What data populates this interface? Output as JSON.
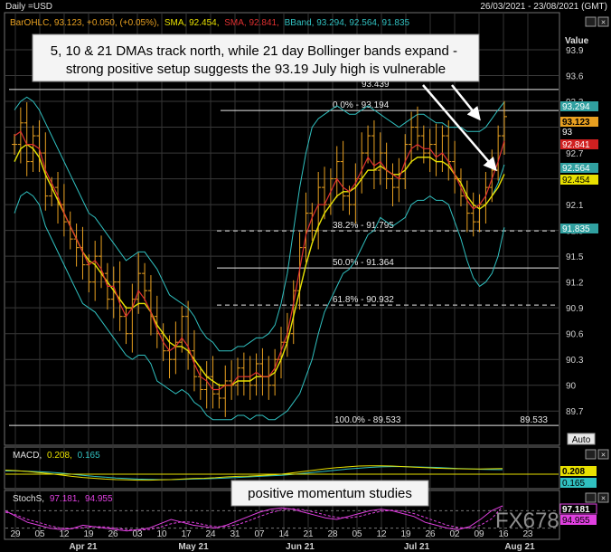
{
  "header": {
    "title": "Daily =USD",
    "date_range": "26/03/2021 - 23/08/2021 (GMT)",
    "value_label": "Value",
    "auto_label": "Auto",
    "watermark": "FX678"
  },
  "legend_main": [
    {
      "text": "BarOHLC, 93.123, +0.050, (+0.05%),",
      "color": "#e8a020"
    },
    {
      "text": "SMA, 92.454,",
      "color": "#e8e000"
    },
    {
      "text": "SMA, 92.841,",
      "color": "#e03030"
    },
    {
      "text": "BBand, 93.294, 92.564, 91.835",
      "color": "#30c0c0"
    }
  ],
  "annotation_main": "5, 10 & 21 DMAs track north, while 21 day Bollinger bands expand - strong positive setup suggests the 93.19 July high is vulnerable",
  "annotation_momentum": "positive momentum studies",
  "macd_legend": {
    "name": "MACD,",
    "v1": "0.208,",
    "v2": "0.165"
  },
  "stoch_legend": {
    "name": "StochS,",
    "v1": "97.181,",
    "v2": "94.955"
  },
  "colors": {
    "bar": "#e8a020",
    "sma_fast": "#e03030",
    "sma_slow": "#e8e000",
    "bband": "#30c0c0",
    "macd_line": "#e8e000",
    "macd_signal": "#30c0c0",
    "stoch_k": "#e040e0",
    "stoch_d": "#e040e0"
  },
  "chart_data": {
    "type": "line",
    "y_range": [
      89.45,
      94.1
    ],
    "y_ticks": [
      "93.9",
      "93.6",
      "93.3",
      "93",
      "92.7",
      "92.4",
      "92.1",
      "91.8",
      "91.5",
      "91.2",
      "90.9",
      "90.6",
      "90.3",
      "90",
      "89.7"
    ],
    "y_tick_values": [
      93.9,
      93.6,
      93.3,
      93.0,
      92.7,
      92.4,
      92.1,
      91.8,
      91.5,
      91.2,
      90.9,
      90.6,
      90.3,
      90.0,
      89.7
    ],
    "x_ticks": [
      "29",
      "05",
      "12",
      "19",
      "26",
      "03",
      "10",
      "17",
      "24",
      "31",
      "07",
      "14",
      "21",
      "28",
      "05",
      "12",
      "19",
      "26",
      "02",
      "09",
      "16",
      "23"
    ],
    "month_labels": [
      "Apr 21",
      "May 21",
      "Jun 21",
      "Jul 21",
      "Aug 21"
    ],
    "levels": [
      {
        "label": "93.439",
        "value": 93.439
      },
      {
        "label": "0.0% - 93.194",
        "value": 93.194
      },
      {
        "label": "38.2% - 91.795",
        "value": 91.795
      },
      {
        "label": "50.0% - 91.364",
        "value": 91.364
      },
      {
        "label": "61.8% - 90.932",
        "value": 90.932
      },
      {
        "label": "100.0% - 89.533",
        "value": 89.533
      }
    ],
    "level_right_label": "89.533",
    "price_tags": [
      {
        "text": "93.294",
        "value": 93.294,
        "bg": "#30a0a0",
        "fg": "#ffffff"
      },
      {
        "text": "93.123",
        "value": 93.123,
        "bg": "#e8a020",
        "fg": "#000000"
      },
      {
        "text": "93",
        "value": 93.0,
        "bg": "#000000",
        "fg": "#ffffff"
      },
      {
        "text": "92.841",
        "value": 92.841,
        "bg": "#d02020",
        "fg": "#ffffff"
      },
      {
        "text": "92.564",
        "value": 92.564,
        "bg": "#30a0a0",
        "fg": "#ffffff"
      },
      {
        "text": "92.454",
        "value": 92.454,
        "bg": "#e8e000",
        "fg": "#000000"
      },
      {
        "text": "91.835",
        "value": 91.835,
        "bg": "#30a0a0",
        "fg": "#ffffff"
      }
    ],
    "close": [
      92.8,
      93.05,
      92.6,
      92.9,
      92.7,
      92.2,
      92.3,
      92.1,
      91.9,
      91.7,
      91.6,
      91.4,
      91.2,
      91.5,
      91.3,
      91.0,
      91.2,
      90.8,
      90.6,
      91.0,
      91.3,
      91.1,
      90.8,
      90.6,
      90.4,
      90.3,
      90.5,
      90.8,
      90.4,
      90.1,
      89.95,
      90.1,
      89.9,
      89.85,
      90.05,
      90.0,
      90.2,
      90.1,
      90.0,
      90.25,
      90.1,
      90.0,
      90.3,
      90.5,
      90.6,
      91.1,
      91.6,
      92.0,
      91.8,
      92.3,
      92.1,
      92.4,
      92.6,
      92.2,
      92.1,
      92.4,
      92.7,
      92.9,
      92.5,
      92.7,
      92.4,
      92.3,
      92.4,
      92.8,
      93.0,
      92.9,
      92.7,
      92.8,
      92.6,
      92.9,
      92.6,
      92.4,
      92.2,
      92.0,
      91.9,
      92.1,
      92.3,
      92.5,
      92.9,
      93.123
    ],
    "sma_fast": [
      92.9,
      92.95,
      92.8,
      92.8,
      92.75,
      92.5,
      92.35,
      92.2,
      92.0,
      91.85,
      91.7,
      91.55,
      91.4,
      91.45,
      91.35,
      91.15,
      91.15,
      90.95,
      90.8,
      90.9,
      91.1,
      91.0,
      90.85,
      90.65,
      90.5,
      90.4,
      90.45,
      90.55,
      90.45,
      90.25,
      90.1,
      90.05,
      89.95,
      89.95,
      90.0,
      90.0,
      90.1,
      90.1,
      90.1,
      90.15,
      90.1,
      90.1,
      90.2,
      90.4,
      90.6,
      90.95,
      91.35,
      91.75,
      91.95,
      92.1,
      92.1,
      92.25,
      92.4,
      92.3,
      92.25,
      92.35,
      92.5,
      92.65,
      92.55,
      92.6,
      92.5,
      92.45,
      92.4,
      92.6,
      92.75,
      92.8,
      92.75,
      92.75,
      92.65,
      92.7,
      92.6,
      92.45,
      92.3,
      92.15,
      92.05,
      92.1,
      92.2,
      92.4,
      92.6,
      92.841
    ],
    "sma_slow": [
      92.6,
      92.75,
      92.8,
      92.75,
      92.65,
      92.45,
      92.3,
      92.15,
      92.0,
      91.85,
      91.7,
      91.55,
      91.45,
      91.4,
      91.3,
      91.2,
      91.1,
      91.0,
      90.9,
      90.9,
      90.95,
      90.95,
      90.85,
      90.7,
      90.6,
      90.5,
      90.45,
      90.45,
      90.4,
      90.3,
      90.2,
      90.1,
      90.05,
      90.0,
      90.0,
      90.0,
      90.05,
      90.05,
      90.05,
      90.1,
      90.1,
      90.1,
      90.15,
      90.3,
      90.5,
      90.8,
      91.1,
      91.4,
      91.65,
      91.85,
      92.0,
      92.1,
      92.2,
      92.25,
      92.25,
      92.3,
      92.4,
      92.5,
      92.5,
      92.55,
      92.5,
      92.45,
      92.45,
      92.5,
      92.6,
      92.65,
      92.65,
      92.65,
      92.6,
      92.6,
      92.55,
      92.45,
      92.35,
      92.2,
      92.1,
      92.05,
      92.1,
      92.2,
      92.3,
      92.454
    ],
    "bb_upper": [
      93.2,
      93.3,
      93.35,
      93.3,
      93.2,
      93.05,
      92.9,
      92.75,
      92.6,
      92.45,
      92.3,
      92.15,
      92.0,
      91.95,
      91.85,
      91.75,
      91.65,
      91.55,
      91.45,
      91.5,
      91.55,
      91.55,
      91.45,
      91.35,
      91.2,
      91.05,
      91.0,
      90.95,
      90.9,
      90.8,
      90.65,
      90.55,
      90.5,
      90.4,
      90.4,
      90.4,
      90.45,
      90.45,
      90.5,
      90.55,
      90.55,
      90.6,
      90.7,
      90.95,
      91.3,
      91.8,
      92.3,
      92.7,
      93.0,
      93.1,
      93.15,
      93.2,
      93.25,
      93.2,
      93.15,
      93.15,
      93.2,
      93.25,
      93.2,
      93.15,
      93.1,
      93.05,
      93.0,
      93.05,
      93.1,
      93.15,
      93.15,
      93.1,
      93.05,
      93.05,
      93.0,
      93.0,
      93.0,
      92.95,
      92.95,
      92.95,
      93.0,
      93.1,
      93.2,
      93.294
    ],
    "bb_mid": [
      92.6,
      92.75,
      92.8,
      92.75,
      92.65,
      92.45,
      92.3,
      92.15,
      92.0,
      91.85,
      91.7,
      91.55,
      91.45,
      91.4,
      91.3,
      91.2,
      91.1,
      91.0,
      90.9,
      90.9,
      90.95,
      90.95,
      90.85,
      90.7,
      90.6,
      90.5,
      90.45,
      90.45,
      90.4,
      90.3,
      90.2,
      90.1,
      90.05,
      90.0,
      90.0,
      90.0,
      90.05,
      90.05,
      90.05,
      90.1,
      90.1,
      90.1,
      90.15,
      90.3,
      90.5,
      90.8,
      91.1,
      91.4,
      91.65,
      91.85,
      92.0,
      92.1,
      92.2,
      92.25,
      92.25,
      92.3,
      92.4,
      92.5,
      92.5,
      92.55,
      92.5,
      92.45,
      92.45,
      92.5,
      92.6,
      92.65,
      92.65,
      92.65,
      92.6,
      92.6,
      92.55,
      92.45,
      92.35,
      92.2,
      92.1,
      92.05,
      92.1,
      92.2,
      92.35,
      92.564
    ],
    "bb_lower": [
      92.0,
      92.2,
      92.25,
      92.2,
      92.1,
      91.85,
      91.7,
      91.55,
      91.4,
      91.25,
      91.1,
      90.95,
      90.9,
      90.85,
      90.75,
      90.65,
      90.55,
      90.45,
      90.35,
      90.3,
      90.35,
      90.35,
      90.25,
      90.05,
      90.0,
      89.95,
      89.9,
      89.95,
      89.9,
      89.8,
      89.75,
      89.65,
      89.6,
      89.6,
      89.6,
      89.6,
      89.65,
      89.65,
      89.6,
      89.65,
      89.65,
      89.6,
      89.6,
      89.65,
      89.7,
      89.8,
      89.9,
      90.1,
      90.3,
      90.6,
      90.85,
      91.0,
      91.15,
      91.3,
      91.35,
      91.45,
      91.6,
      91.75,
      91.8,
      91.95,
      91.9,
      91.85,
      91.9,
      91.95,
      92.1,
      92.15,
      92.15,
      92.2,
      92.15,
      92.15,
      92.1,
      91.9,
      91.7,
      91.45,
      91.25,
      91.15,
      91.2,
      91.3,
      91.5,
      91.835
    ],
    "macd": [
      0.15,
      0.13,
      0.1,
      0.06,
      0.02,
      -0.03,
      -0.08,
      -0.12,
      -0.15,
      -0.18,
      -0.2,
      -0.21,
      -0.22,
      -0.22,
      -0.21,
      -0.2,
      -0.18,
      -0.16,
      -0.15,
      -0.13,
      -0.1,
      -0.08,
      -0.07,
      -0.05,
      -0.03,
      0.0,
      0.05,
      0.1,
      0.15,
      0.2,
      0.24,
      0.27,
      0.3,
      0.31,
      0.31,
      0.3,
      0.28,
      0.26,
      0.24,
      0.22,
      0.21,
      0.2,
      0.19,
      0.19,
      0.2,
      0.208
    ],
    "macd_signal": [
      0.12,
      0.12,
      0.11,
      0.09,
      0.07,
      0.04,
      0.0,
      -0.04,
      -0.08,
      -0.11,
      -0.14,
      -0.16,
      -0.18,
      -0.19,
      -0.2,
      -0.2,
      -0.19,
      -0.18,
      -0.17,
      -0.16,
      -0.14,
      -0.12,
      -0.1,
      -0.08,
      -0.06,
      -0.04,
      -0.01,
      0.03,
      0.07,
      0.11,
      0.15,
      0.19,
      0.22,
      0.25,
      0.27,
      0.28,
      0.28,
      0.27,
      0.26,
      0.25,
      0.23,
      0.21,
      0.2,
      0.18,
      0.17,
      0.165
    ],
    "stoch_k": [
      80,
      60,
      40,
      30,
      20,
      15,
      18,
      30,
      25,
      20,
      15,
      10,
      15,
      20,
      35,
      50,
      40,
      30,
      25,
      20,
      30,
      45,
      60,
      75,
      85,
      90,
      85,
      75,
      65,
      55,
      50,
      60,
      70,
      80,
      85,
      80,
      70,
      60,
      40,
      30,
      20,
      15,
      25,
      50,
      80,
      97.181
    ],
    "stoch_d": [
      75,
      65,
      50,
      40,
      28,
      20,
      18,
      22,
      25,
      24,
      20,
      15,
      13,
      15,
      23,
      35,
      42,
      40,
      32,
      25,
      25,
      32,
      45,
      60,
      73,
      83,
      87,
      83,
      75,
      65,
      57,
      55,
      60,
      70,
      78,
      82,
      78,
      70,
      57,
      43,
      30,
      22,
      20,
      30,
      52,
      94.955
    ]
  }
}
